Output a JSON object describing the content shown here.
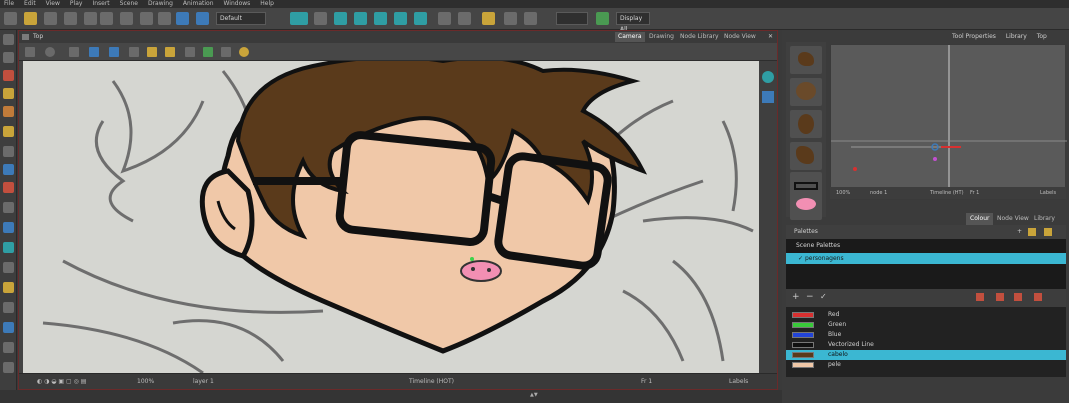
{
  "menu": [
    "File",
    "Edit",
    "View",
    "Play",
    "Insert",
    "Scene",
    "Drawing",
    "Animation",
    "Windows",
    "Help"
  ],
  "toolbar": {
    "mode_select": "Default",
    "display_select": "Display All"
  },
  "camera_view": {
    "title": "Top",
    "tabs": [
      "Camera",
      "Drawing",
      "Node Library",
      "Node View"
    ],
    "active_tab": "Camera",
    "status": {
      "zoom": "100%",
      "layer": "layer 1",
      "frame_info": "Timeline (HOT)",
      "fr": "Fr 1",
      "sel": "Labels"
    }
  },
  "right_panel": {
    "tabs": [
      "Tool Properties",
      "Library",
      "Top"
    ],
    "status": {
      "zoom": "100%",
      "layer": "node 1",
      "frame_info": "Timeline (HT)",
      "fr": "Fr 1",
      "label": "Labels"
    },
    "colour_tabs": [
      "Colour",
      "Node View",
      "Library"
    ],
    "palettes_title": "Palettes",
    "scene_palettes_label": "Scene Palettes",
    "palette_name": "personagens",
    "swatches": [
      {
        "name": "Red",
        "color": "#d83030"
      },
      {
        "name": "Green",
        "color": "#39c93a"
      },
      {
        "name": "Blue",
        "color": "#2244d8"
      },
      {
        "name": "Vectorized Line",
        "color": "#111111"
      },
      {
        "name": "cabelo",
        "color": "#5a3a1b",
        "selected": true
      },
      {
        "name": "pele",
        "color": "#f0c8a8"
      }
    ]
  }
}
